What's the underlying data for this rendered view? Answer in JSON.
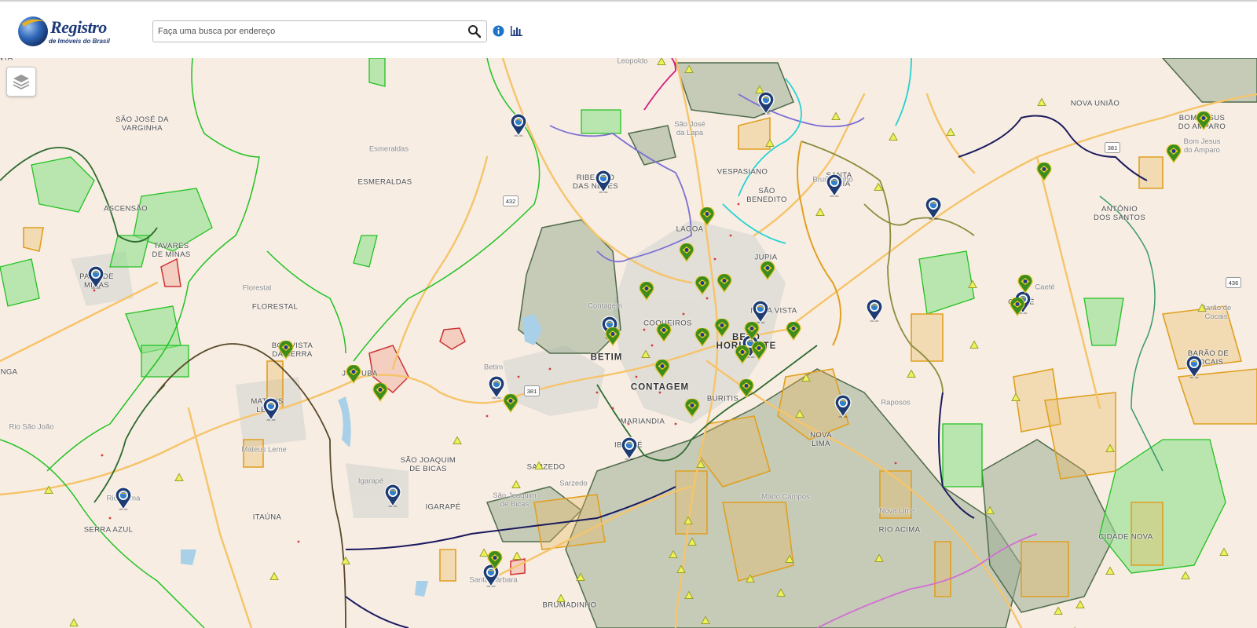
{
  "header": {
    "logo_title": "Registro",
    "logo_subtitle": "de Imóveis do Brasil",
    "search_placeholder": "Faça uma busca por endereço",
    "icons": [
      "search-icon",
      "info-icon",
      "bar-chart-icon"
    ]
  },
  "map": {
    "layers_control_icon": "layers-icon",
    "colors": {
      "background": "#f7ede3",
      "roads": "#f6c46a",
      "green_boundary": "#22c222",
      "dark_green_boundary": "#2e6b2e",
      "orange_area": "#e0a020",
      "olive_area": "#8c8c3c",
      "navy_boundary": "#1a1a5e",
      "purple_boundary": "#7b6fd4",
      "cyan_boundary": "#22d3d3",
      "pin_blue": "#1f3c72",
      "cert_green": "#3c8c1e"
    },
    "labels": [
      {
        "text": "Leopoldo",
        "small": true
      },
      {
        "text": "NOVA UNIÃO"
      },
      {
        "text": "SÃO JOSÉ DA\nVARGINHA"
      },
      {
        "text": "São José\nda Lapa",
        "small": true
      },
      {
        "text": "BOM JESUS\nDO AMPARO"
      },
      {
        "text": "Bom Jesus\ndo Amparo",
        "small": true
      },
      {
        "text": "Esmeraldas",
        "small": true
      },
      {
        "text": "ESMERALDAS"
      },
      {
        "text": "RIBEIRÃO\nDAS NEVES"
      },
      {
        "text": "VESPASIANO"
      },
      {
        "text": "SANTA\nLUZIA"
      },
      {
        "text": "SÃO\nBENEDITO"
      },
      {
        "text": "ASCENSÃO"
      },
      {
        "text": "LAGOA"
      },
      {
        "text": "ANTÔNIO\nDOS SANTOS"
      },
      {
        "text": "TAVARES\nDE MINAS"
      },
      {
        "text": "JUPIA"
      },
      {
        "text": "Caeté",
        "small": true
      },
      {
        "text": "Florestal",
        "small": true
      },
      {
        "text": "FLORESTAL"
      },
      {
        "text": "Contagem",
        "small": true
      },
      {
        "text": "NOVA VISTA"
      },
      {
        "text": "CAETÉ"
      },
      {
        "text": "Barão de\nCocais",
        "small": true
      },
      {
        "text": "PARÁ DE\nMINAS"
      },
      {
        "text": "COQUEIROS"
      },
      {
        "text": "BELO\nHORIZONTE",
        "big": true
      },
      {
        "text": "BOA VISTA\nDA SERRA"
      },
      {
        "text": "BETIM",
        "big": true
      },
      {
        "text": "Betim",
        "small": true
      },
      {
        "text": "JUATUBA"
      },
      {
        "text": "BARÃO DE\nCOCAIS"
      },
      {
        "text": "CONTAGEM",
        "big": true
      },
      {
        "text": "BURITIS"
      },
      {
        "text": "INGA"
      },
      {
        "text": "Raposos",
        "small": true
      },
      {
        "text": "MATEUS\nLEME"
      },
      {
        "text": "MARIANDIA"
      },
      {
        "text": "IBIRITÉ"
      },
      {
        "text": "NOVA\nLIMA"
      },
      {
        "text": "Mateus Leme",
        "small": true
      },
      {
        "text": "SÃO JOAQUIM\nDE BICAS"
      },
      {
        "text": "SARZEDO"
      },
      {
        "text": "Rio São João",
        "small": true
      },
      {
        "text": "Sarzedo",
        "small": true
      },
      {
        "text": "Igarapé",
        "small": true
      },
      {
        "text": "IGARAPÉ"
      },
      {
        "text": "São Joaquim\nde Bicas",
        "small": true
      },
      {
        "text": "Mário Campos",
        "small": true
      },
      {
        "text": "Nova Lima",
        "small": true
      },
      {
        "text": "RIO ACIMA"
      },
      {
        "text": "Rio Acima",
        "small": true
      },
      {
        "text": "ITAÚNA"
      },
      {
        "text": "SERRA AZUL"
      },
      {
        "text": "CIDADE NOVA"
      },
      {
        "text": "Santa Bárbara",
        "small": true
      },
      {
        "text": "BRUMADINHO"
      },
      {
        "text": "Brumadinho",
        "small": true
      },
      {
        "text": "SANTA"
      }
    ],
    "road_shields": [
      "381",
      "432",
      "381",
      "436"
    ]
  }
}
